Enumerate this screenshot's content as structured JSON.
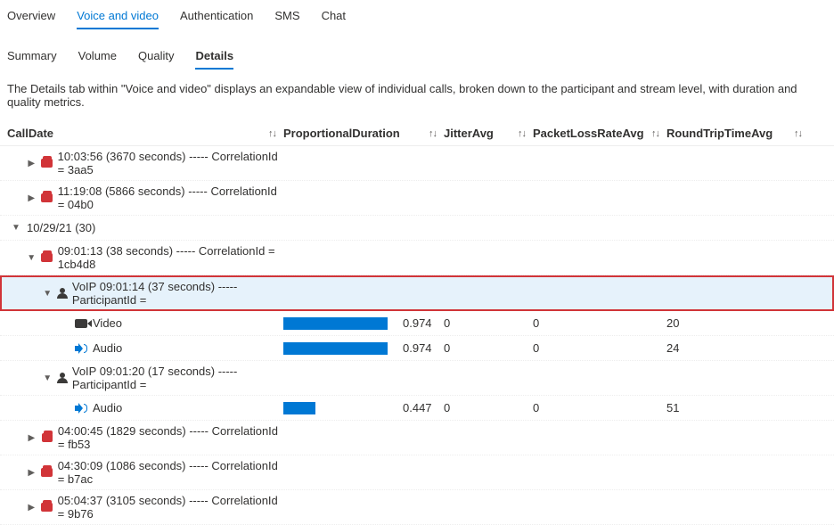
{
  "tabs_primary": {
    "items": [
      "Overview",
      "Voice and video",
      "Authentication",
      "SMS",
      "Chat"
    ],
    "active_index": 1
  },
  "tabs_secondary": {
    "items": [
      "Summary",
      "Volume",
      "Quality",
      "Details"
    ],
    "active_index": 3
  },
  "description": "The Details tab within \"Voice and video\" displays an expandable view of individual calls, broken down to the participant and stream level, with duration and quality metrics.",
  "columns": {
    "calldate": "CallDate",
    "propdur": "ProportionalDuration",
    "jitter": "JitterAvg",
    "packet": "PacketLossRateAvg",
    "roundtrip": "RoundTripTimeAvg"
  },
  "rows": {
    "r0": {
      "caret": "right",
      "indent": 1,
      "icon": "phone",
      "label": "10:03:56 (3670 seconds) ----- CorrelationId = 3aa5"
    },
    "r1": {
      "caret": "right",
      "indent": 1,
      "icon": "phone",
      "label": "11:19:08 (5866 seconds) ----- CorrelationId = 04b0"
    },
    "r2": {
      "caret": "down",
      "indent": 0,
      "icon": "",
      "label": "10/29/21 (30)"
    },
    "r3": {
      "caret": "down",
      "indent": 1,
      "icon": "phone",
      "label": "09:01:13 (38 seconds) ----- CorrelationId = 1cb4d8"
    },
    "r4": {
      "caret": "down",
      "indent": 2,
      "icon": "person",
      "label": "VoIP 09:01:14 (37 seconds) ----- ParticipantId =",
      "highlight": true
    },
    "r5": {
      "caret": "",
      "indent": 3,
      "icon": "video",
      "label": "Video",
      "bar": 0.974,
      "propdur": "0.974",
      "jitter": "0",
      "packet": "0",
      "roundtrip": "20"
    },
    "r6": {
      "caret": "",
      "indent": 3,
      "icon": "audio",
      "label": "Audio",
      "bar": 0.974,
      "propdur": "0.974",
      "jitter": "0",
      "packet": "0",
      "roundtrip": "24"
    },
    "r7": {
      "caret": "down",
      "indent": 2,
      "icon": "person",
      "label": "VoIP 09:01:20 (17 seconds) ----- ParticipantId ="
    },
    "r8": {
      "caret": "",
      "indent": 3,
      "icon": "audio",
      "label": "Audio",
      "bar": 0.3,
      "propdur": "0.447",
      "jitter": "0",
      "packet": "0",
      "roundtrip": "51"
    },
    "r9": {
      "caret": "right",
      "indent": 1,
      "icon": "phone",
      "label": "04:00:45 (1829 seconds) ----- CorrelationId = fb53"
    },
    "r10": {
      "caret": "right",
      "indent": 1,
      "icon": "phone",
      "label": "04:30:09 (1086 seconds) ----- CorrelationId = b7ac"
    },
    "r11": {
      "caret": "right",
      "indent": 1,
      "icon": "phone",
      "label": "05:04:37 (3105 seconds) ----- CorrelationId = 9b76"
    }
  },
  "chart_data": {
    "type": "table",
    "columns": [
      "CallDate",
      "ProportionalDuration",
      "JitterAvg",
      "PacketLossRateAvg",
      "RoundTripTimeAvg"
    ],
    "rows": [
      {
        "CallDate": "Video (under VoIP 09:01:14)",
        "ProportionalDuration": 0.974,
        "JitterAvg": 0,
        "PacketLossRateAvg": 0,
        "RoundTripTimeAvg": 20
      },
      {
        "CallDate": "Audio (under VoIP 09:01:14)",
        "ProportionalDuration": 0.974,
        "JitterAvg": 0,
        "PacketLossRateAvg": 0,
        "RoundTripTimeAvg": 24
      },
      {
        "CallDate": "Audio (under VoIP 09:01:20)",
        "ProportionalDuration": 0.447,
        "JitterAvg": 0,
        "PacketLossRateAvg": 0,
        "RoundTripTimeAvg": 51
      }
    ]
  }
}
